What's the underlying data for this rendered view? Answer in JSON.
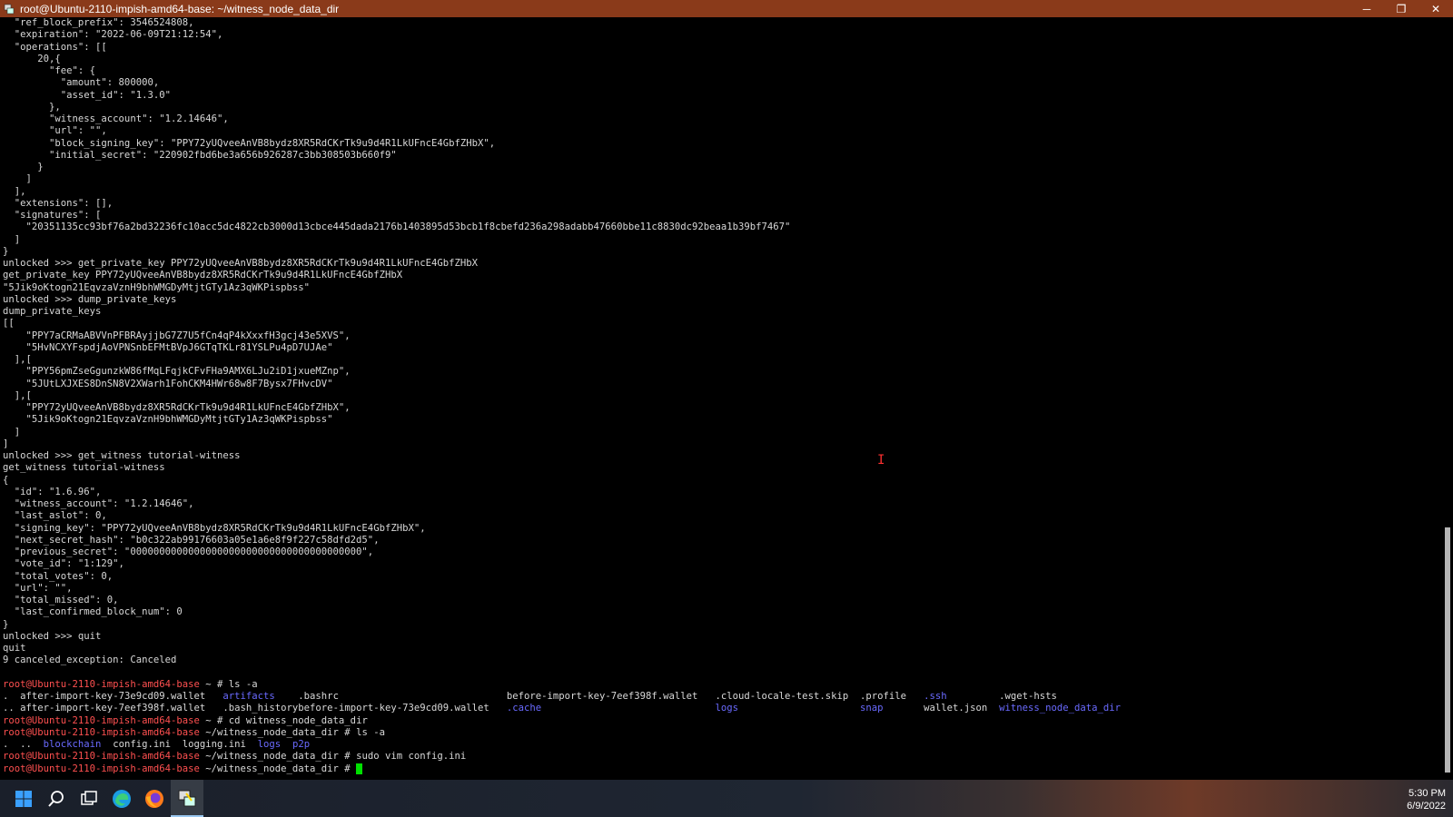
{
  "window": {
    "title": "root@Ubuntu-2110-impish-amd64-base: ~/witness_node_data_dir",
    "minimize": "─",
    "restore": "❐",
    "close": "✕"
  },
  "terminal": {
    "lines": [
      "  \"ref_block_prefix\": 3546524808,",
      "  \"expiration\": \"2022-06-09T21:12:54\",",
      "  \"operations\": [[",
      "      20,{",
      "        \"fee\": {",
      "          \"amount\": 800000,",
      "          \"asset_id\": \"1.3.0\"",
      "        },",
      "        \"witness_account\": \"1.2.14646\",",
      "        \"url\": \"\",",
      "        \"block_signing_key\": \"PPY72yUQveeAnVB8bydz8XR5RdCKrTk9u9d4R1LkUFncE4GbfZHbX\",",
      "        \"initial_secret\": \"220902fbd6be3a656b926287c3bb308503b660f9\"",
      "      }",
      "    ]",
      "  ],",
      "  \"extensions\": [],",
      "  \"signatures\": [",
      "    \"20351135cc93bf76a2bd32236fc10acc5dc4822cb3000d13cbce445dada2176b1403895d53bcb1f8cbefd236a298adabb47660bbe11c8830dc92beaa1b39bf7467\"",
      "  ]",
      "}",
      "unlocked >>> get_private_key PPY72yUQveeAnVB8bydz8XR5RdCKrTk9u9d4R1LkUFncE4GbfZHbX",
      "get_private_key PPY72yUQveeAnVB8bydz8XR5RdCKrTk9u9d4R1LkUFncE4GbfZHbX",
      "\"5Jik9oKtogn21EqvzaVznH9bhWMGDyMtjtGTy1Az3qWKPispbss\"",
      "unlocked >>> dump_private_keys",
      "dump_private_keys",
      "[[",
      "    \"PPY7aCRMaABVVnPFBRAyjjbG7Z7U5fCn4qP4kXxxfH3gcj43e5XVS\",",
      "    \"5HvNCXYFspdjAoVPNSnbEFMtBVpJ6GTqTKLr81YSLPu4pD7UJAe\"",
      "  ],[",
      "    \"PPY56pmZseGgunzkW86fMqLFqjkCFvFHa9AMX6LJu2iD1jxueMZnp\",",
      "    \"5JUtLXJXES8DnSN8V2XWarh1FohCKM4HWr68w8F7Bysx7FHvcDV\"",
      "  ],[",
      "    \"PPY72yUQveeAnVB8bydz8XR5RdCKrTk9u9d4R1LkUFncE4GbfZHbX\",",
      "    \"5Jik9oKtogn21EqvzaVznH9bhWMGDyMtjtGTy1Az3qWKPispbss\"",
      "  ]",
      "]",
      "unlocked >>> get_witness tutorial-witness",
      "get_witness tutorial-witness",
      "{",
      "  \"id\": \"1.6.96\",",
      "  \"witness_account\": \"1.2.14646\",",
      "  \"last_aslot\": 0,",
      "  \"signing_key\": \"PPY72yUQveeAnVB8bydz8XR5RdCKrTk9u9d4R1LkUFncE4GbfZHbX\",",
      "  \"next_secret_hash\": \"b0c322ab99176603a05e1a6e8f9f227c58dfd2d5\",",
      "  \"previous_secret\": \"0000000000000000000000000000000000000000\",",
      "  \"vote_id\": \"1:129\",",
      "  \"total_votes\": 0,",
      "  \"url\": \"\",",
      "  \"total_missed\": 0,",
      "  \"last_confirmed_block_num\": 0",
      "}",
      "unlocked >>> quit",
      "quit",
      "9 canceled_exception: Canceled",
      ""
    ],
    "prompt": "root@Ubuntu-2110-impish-amd64-base",
    "session": [
      {
        "cwd": " ~ # ",
        "cmd": "ls -a"
      },
      {
        "cwd": " ~ # ",
        "cmd": "cd witness_node_data_dir"
      },
      {
        "cwd": " ~/witness_node_data_dir # ",
        "cmd": "ls -a"
      },
      {
        "cwd": " ~/witness_node_data_dir # ",
        "cmd": "sudo vim config.ini"
      },
      {
        "cwd": " ~/witness_node_data_dir # ",
        "cmd": ""
      }
    ],
    "ls_home": [
      [
        ".",
        "after-import-key-73e9cd09.wallet",
        "artifacts",
        ".bashrc",
        "before-import-key-7eef398f.wallet",
        ".cloud-locale-test.skip",
        ".profile",
        ".ssh",
        ".wget-hsts"
      ],
      [
        "..",
        "after-import-key-7eef398f.wallet",
        ".bash_history",
        "before-import-key-73e9cd09.wallet",
        ".cache",
        "logs",
        "snap",
        "wallet.json",
        "witness_node_data_dir"
      ]
    ],
    "ls_home_dirs": [
      [
        false,
        false,
        true,
        false,
        false,
        false,
        false,
        true,
        false
      ],
      [
        false,
        false,
        false,
        false,
        true,
        true,
        true,
        false,
        true
      ]
    ],
    "ls_witness": [
      ".",
      "..",
      "blockchain",
      "config.ini",
      "logging.ini",
      "logs",
      "p2p"
    ],
    "ls_witness_dirs": [
      false,
      false,
      true,
      false,
      false,
      true,
      true
    ]
  },
  "colors": {
    "prompt": "#ff5050",
    "directory": "#6a6aff",
    "cursor": "#00e000",
    "titlebar": "#8a3a1a"
  },
  "taskbar": {
    "time": "5:30 PM",
    "date": "6/9/2022",
    "icons": [
      "windows-start-icon",
      "search-icon",
      "task-view-icon",
      "edge-browser-icon",
      "firefox-icon",
      "putty-icon"
    ]
  }
}
